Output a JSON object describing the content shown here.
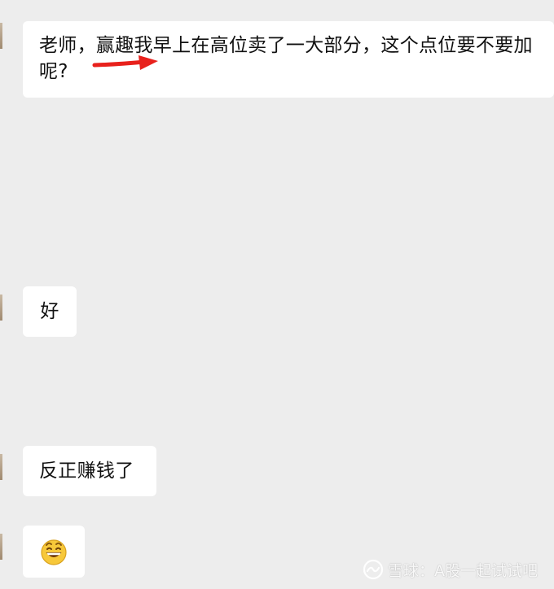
{
  "messages": [
    {
      "text": "老师，赢趣我早上在高位卖了一大部分，这个点位要不要加呢?"
    },
    {
      "text": "好"
    },
    {
      "text": "反正赚钱了"
    },
    {
      "emoji": "grinning-face-emoji"
    }
  ],
  "watermark": {
    "text": "雪球：A股一起试试吧",
    "icon": "snowball-logo-icon"
  },
  "colors": {
    "background": "#ededed",
    "bubble": "#ffffff",
    "annotation_arrow": "#e8211c"
  }
}
